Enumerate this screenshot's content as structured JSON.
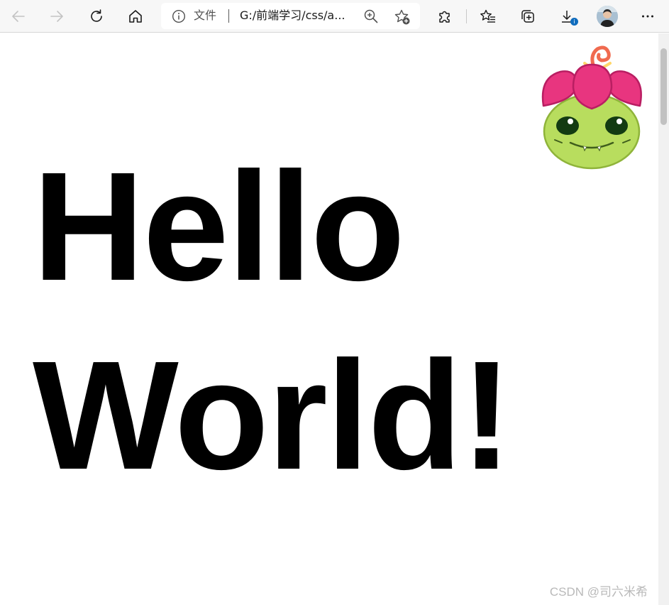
{
  "browser": {
    "address_bar": {
      "page_label": "文件",
      "url_display": "G:/前端学习/css/a..."
    },
    "downloads_badge": "i",
    "icons": [
      "back-icon",
      "forward-icon",
      "refresh-icon",
      "home-icon",
      "info-icon",
      "zoom-icon",
      "add-favorite-icon",
      "extensions-icon",
      "favorites-icon",
      "collections-icon",
      "downloads-icon",
      "profile-avatar",
      "more-icon"
    ]
  },
  "page": {
    "heading_line1": "Hello",
    "heading_line2": "World!",
    "heading_color": "#000000"
  },
  "watermark": "CSDN @司六米希",
  "colors": {
    "toolbar_bg": "#f7f7f7",
    "mascot_petals": "#e8357f",
    "mascot_face": "#b8dd5e",
    "mascot_antenna": "#f06a4f"
  }
}
